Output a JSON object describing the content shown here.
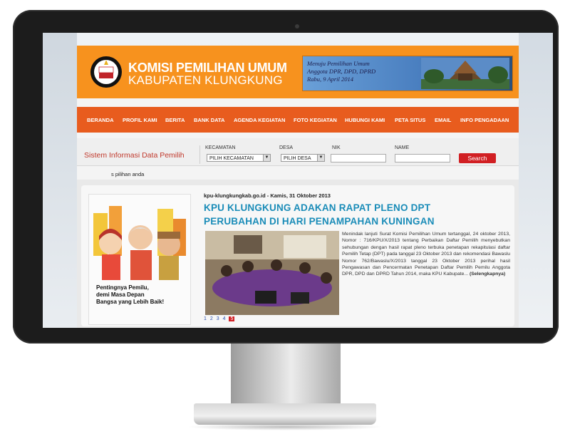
{
  "header": {
    "title": "KOMISI PEMILIHAN UMUM",
    "subtitle": "KABUPATEN KLUNGKUNG",
    "banner_lines": [
      "Menuju Pemilihan Umum",
      "Anggota DPR, DPD, DPRD",
      "Rabu, 9 April 2014"
    ]
  },
  "nav": [
    "BERANDA",
    "PROFIL KAMI",
    "BERITA",
    "BANK DATA",
    "AGENDA KEGIATAN",
    "FOTO KEGIATAN",
    "HUBUNGI KAMI",
    "PETA SITUS",
    "EMAIL",
    "INFO PENGADAAN"
  ],
  "search_panel": {
    "title": "Sistem Informasi Data Pemilih",
    "kecamatan_label": "KECAMATAN",
    "kecamatan_value": "PILIH KECAMATAN",
    "desa_label": "DESA",
    "desa_value": "PILIH DESA",
    "nik_label": "NIK",
    "name_label": "NAME",
    "search_button": "Search"
  },
  "marquee": "s pilihan anda",
  "poster": {
    "line1": "Pentingnya Pemilu,",
    "line2": "demi Masa Depan",
    "line3": "Bangsa yang Lebih Baik!"
  },
  "article": {
    "meta": "kpu-klungkungkab.go.id - Kamis, 31 Oktober 2013",
    "title_line1": "KPU KLUNGKUNG ADAKAN RAPAT PLENO DPT",
    "title_line2": "PERUBAHAN DI HARI PENAMPAHAN KUNINGAN",
    "excerpt": "Menindak lanjuti Surat Komisi Pemilihan Umum tertanggal, 24 oktober 2013, Nomor : 716/KPU/X/2013 tentang Perbaikan Daftar Pemilih menyebutkan sehubungan dengan hasil rapat pleno terbuka penetapan rekapitulasi daftar Pemilih Tetap (DPT) pada tanggal 23 Oktober 2013 dan rekomendasi Bawaslu Nomor 762/Bawaslu/X/2013 tanggal 23 Oktober 2013 perihal hasil Pengawasan dan Pencermatan Penetapan Daftar Pemilih Pemilu Anggota DPR, DPD dan DPRD Tahun 2014, maka KPU Kabupate...",
    "more": "(Selengkapnya)"
  },
  "pager": {
    "pages": [
      "1",
      "2",
      "3",
      "4",
      "5"
    ],
    "active": "5"
  }
}
